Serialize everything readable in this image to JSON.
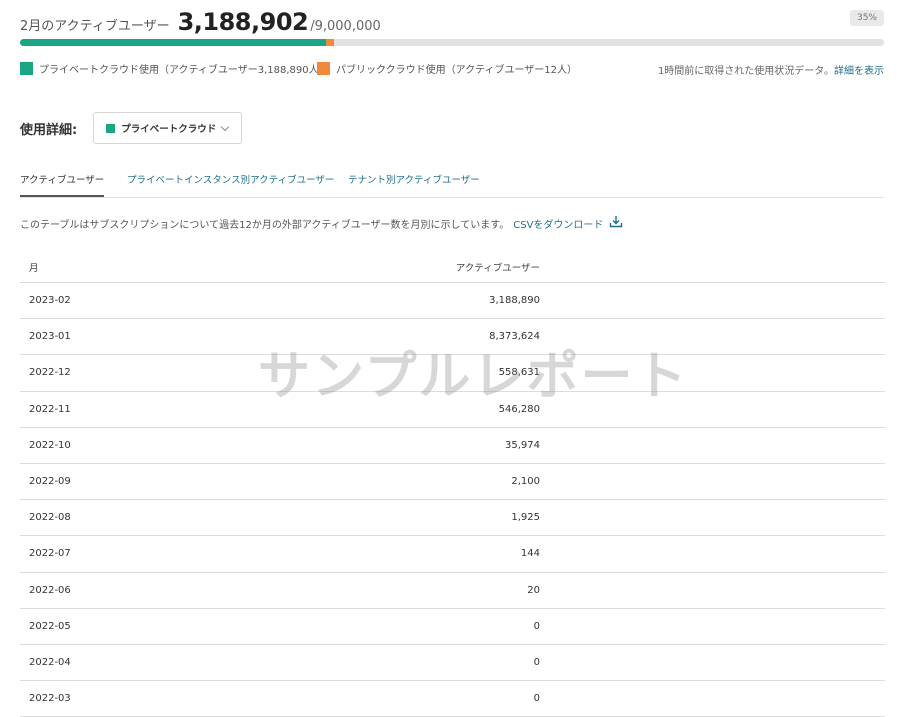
{
  "summary": {
    "label": "2月のアクティブユーザー",
    "value": "3,188,902",
    "total": "/9,000,000",
    "percent_badge": "35%",
    "private_fraction": 0.354,
    "public_fraction": 0.009
  },
  "colors": {
    "private": "#1aa583",
    "public": "#f08a3a",
    "link": "#1f6f8b"
  },
  "legend": {
    "private": "プライベートクラウド使用（アクティブユーザー3,188,890人）",
    "public": "パブリッククラウド使用（アクティブユーザー12人）",
    "updated_text": "1時間前に取得された使用状況データ。",
    "details_link": "詳細を表示"
  },
  "detail": {
    "label": "使用詳細:",
    "dropdown_value": "プライベートクラウド"
  },
  "tabs": [
    {
      "label": "アクティブユーザー",
      "active": true
    },
    {
      "label": "プライベートインスタンス別アクティブユーザー",
      "active": false
    },
    {
      "label": "テナント別アクティブユーザー",
      "active": false
    }
  ],
  "description": {
    "text": "このテーブルはサブスクリプションについて過去12か月の外部アクティブユーザー数を月別に示しています。",
    "csv_link": "CSVをダウンロード",
    "csv_icon": "download-icon"
  },
  "table": {
    "headers": {
      "month": "月",
      "active_users": "アクティブユーザー"
    },
    "rows": [
      {
        "month": "2023-02",
        "users": "3,188,890"
      },
      {
        "month": "2023-01",
        "users": "8,373,624"
      },
      {
        "month": "2022-12",
        "users": "558,631"
      },
      {
        "month": "2022-11",
        "users": "546,280"
      },
      {
        "month": "2022-10",
        "users": "35,974"
      },
      {
        "month": "2022-09",
        "users": "2,100"
      },
      {
        "month": "2022-08",
        "users": "1,925"
      },
      {
        "month": "2022-07",
        "users": "144"
      },
      {
        "month": "2022-06",
        "users": "20"
      },
      {
        "month": "2022-05",
        "users": "0"
      },
      {
        "month": "2022-04",
        "users": "0"
      },
      {
        "month": "2022-03",
        "users": "0"
      }
    ]
  },
  "watermark": "サンプルレポート"
}
